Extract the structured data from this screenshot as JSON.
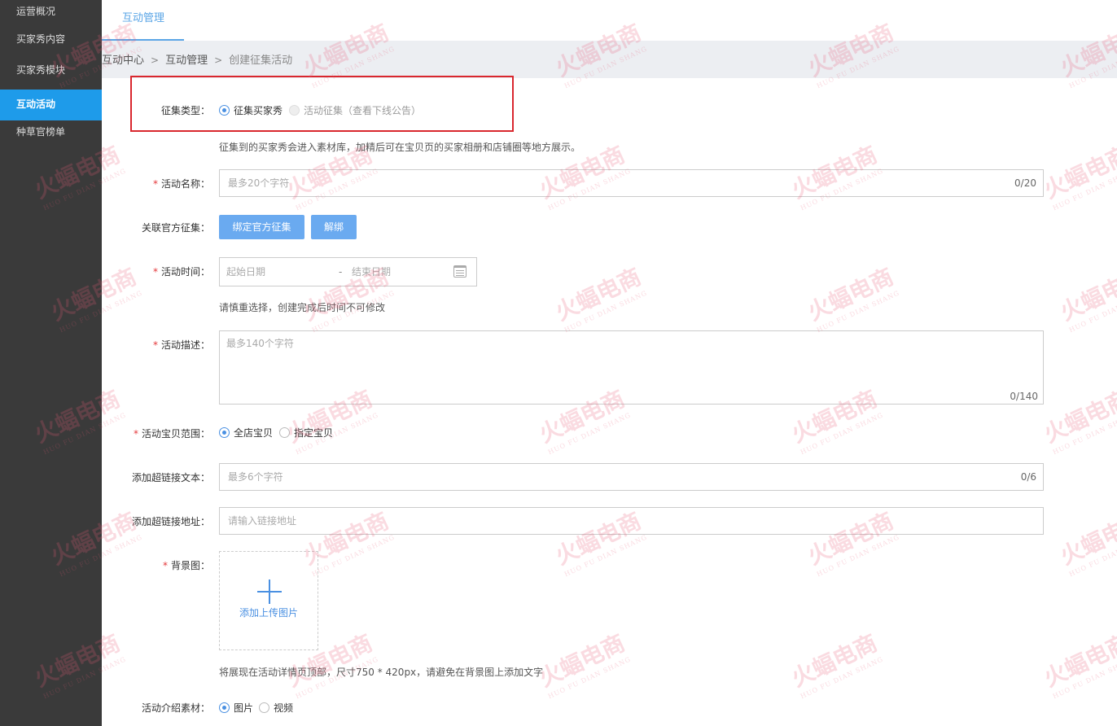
{
  "sidebar": {
    "items": [
      {
        "label": "运营概况"
      },
      {
        "label": "买家秀内容"
      },
      {
        "label": "买家秀模块"
      },
      {
        "label": "互动活动"
      },
      {
        "label": "种草官榜单"
      }
    ]
  },
  "tabs": [
    {
      "label": "互动管理"
    }
  ],
  "breadcrumb": {
    "crumb1": "互动中心",
    "crumb2": "互动管理",
    "current": "创建征集活动"
  },
  "form": {
    "collect_type": {
      "label": "征集类型：",
      "option1": "征集买家秀",
      "option2": "活动征集（查看下线公告）",
      "hint": "征集到的买家秀会进入素材库，加精后可在宝贝页的买家相册和店铺圈等地方展示。"
    },
    "activity_name": {
      "label": "活动名称：",
      "placeholder": "最多20个字符",
      "counter": "0/20"
    },
    "official": {
      "label": "关联官方征集：",
      "bind_button": "绑定官方征集",
      "unbind_button": "解绑"
    },
    "activity_time": {
      "label": "活动时间：",
      "start_placeholder": "起始日期",
      "dash": "-",
      "end_placeholder": "结束日期",
      "hint": "请慎重选择，创建完成后时间不可修改"
    },
    "description": {
      "label": "活动描述：",
      "placeholder": "最多140个字符",
      "counter": "0/140"
    },
    "item_scope": {
      "label": "活动宝贝范围：",
      "option1": "全店宝贝",
      "option2": "指定宝贝"
    },
    "link_text": {
      "label": "添加超链接文本：",
      "placeholder": "最多6个字符",
      "counter": "0/6"
    },
    "link_url": {
      "label": "添加超链接地址：",
      "placeholder": "请输入链接地址"
    },
    "background": {
      "label": "背景图：",
      "upload_label": "添加上传图片",
      "hint": "将展现在活动详情页顶部，尺寸750 * 420px，请避免在背景图上添加文字"
    },
    "intro_material": {
      "label": "活动介绍素材：",
      "option1": "图片",
      "option2": "视频"
    }
  },
  "watermark": {
    "text": "火蝠电商",
    "sub": "HUO FU DIAN SHANG"
  },
  "colors": {
    "accent": "#1e9bea",
    "button": "#6aaaf0",
    "required": "#e4393c",
    "highlight_box": "#d9272e"
  }
}
